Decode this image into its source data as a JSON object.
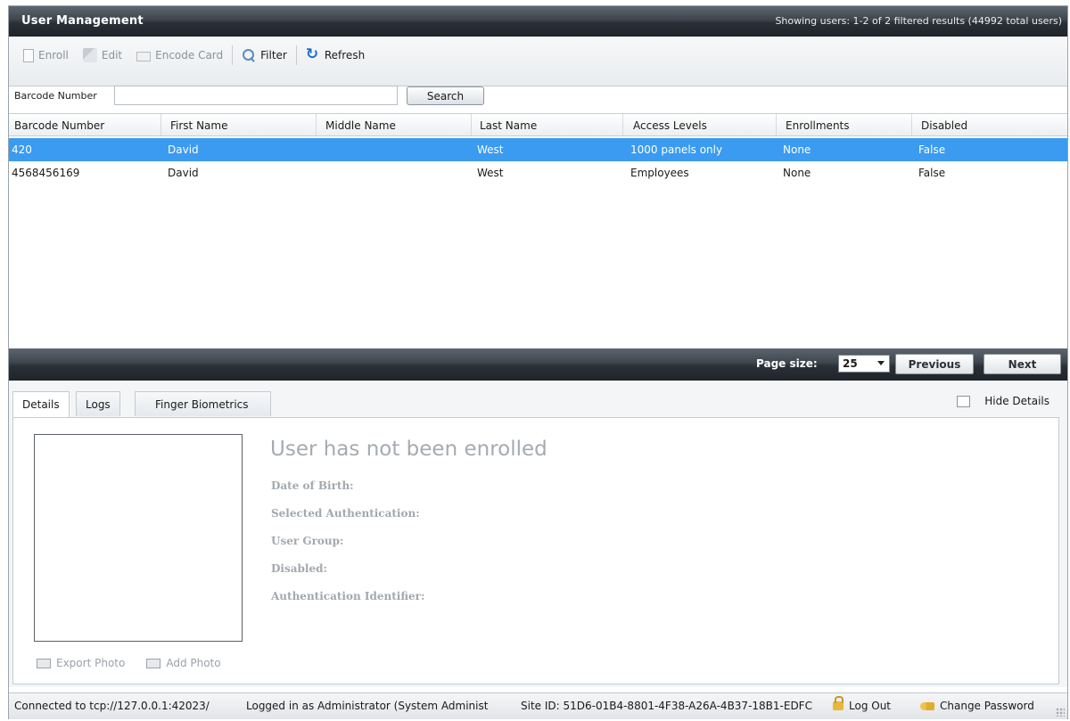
{
  "window": {
    "title": "User Management",
    "results_status": "Showing users: 1-2 of 2 filtered results (44992 total users)"
  },
  "toolbar": {
    "enroll": "Enroll",
    "edit": "Edit",
    "encode_card": "Encode Card",
    "filter": "Filter",
    "refresh": "Refresh"
  },
  "search": {
    "label": "Barcode Number",
    "value": "",
    "button": "Search"
  },
  "grid": {
    "columns": [
      "Barcode Number",
      "First Name",
      "Middle Name",
      "Last Name",
      "Access Levels",
      "Enrollments",
      "Disabled"
    ],
    "rows": [
      {
        "barcode": "420",
        "first": "David",
        "middle": "",
        "last": "West",
        "access": "1000 panels only",
        "enrollments": "None",
        "disabled": "False",
        "selected": true
      },
      {
        "barcode": "4568456169",
        "first": "David",
        "middle": "",
        "last": "West",
        "access": "Employees",
        "enrollments": "None",
        "disabled": "False",
        "selected": false
      }
    ]
  },
  "pager": {
    "page_size_label": "Page size:",
    "page_size": "25",
    "previous": "Previous",
    "next": "Next"
  },
  "details": {
    "tabs": [
      "Details",
      "Logs",
      "Finger Biometrics"
    ],
    "active_tab": "Details",
    "hide_details": "Hide Details",
    "heading": "User has not been enrolled",
    "fields": [
      "Date of Birth:",
      "Selected Authentication:",
      "User Group:",
      "Disabled:",
      "Authentication Identifier:"
    ],
    "export_photo": "Export Photo",
    "add_photo": "Add Photo"
  },
  "statusbar": {
    "connection": "Connected to tcp://127.0.0.1:42023/",
    "logged_in": "Logged in as Administrator (System Administ",
    "site_id": "Site ID: 51D6-01B4-8801-4F38-A26A-4B37-18B1-EDFC",
    "log_out": "Log Out",
    "change_password": "Change Password"
  },
  "colors": {
    "selected_row": "#3a9bf0",
    "title_bar": "#2a3037",
    "refresh_icon": "#1e6fd0"
  }
}
